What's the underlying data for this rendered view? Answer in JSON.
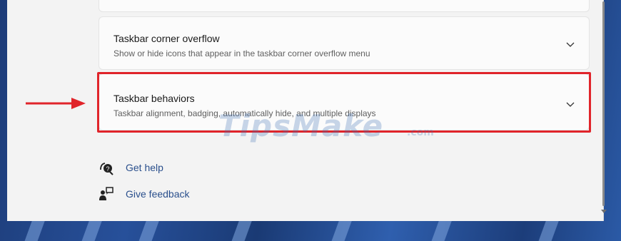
{
  "settings": {
    "overflow": {
      "title": "Taskbar corner overflow",
      "description": "Show or hide icons that appear in the taskbar corner overflow menu"
    },
    "behaviors": {
      "title": "Taskbar behaviors",
      "description": "Taskbar alignment, badging, automatically hide, and multiple displays"
    }
  },
  "links": {
    "help": "Get help",
    "feedback": "Give feedback"
  },
  "watermark": {
    "text": "TipsMake",
    "suffix": ".com"
  },
  "colors": {
    "highlight": "#e0242a",
    "link": "#2a4f8c"
  },
  "icons": {
    "chevron": "chevron-down-icon",
    "help": "get-help-icon",
    "feedback": "give-feedback-icon",
    "arrow": "red-arrow-icon"
  }
}
